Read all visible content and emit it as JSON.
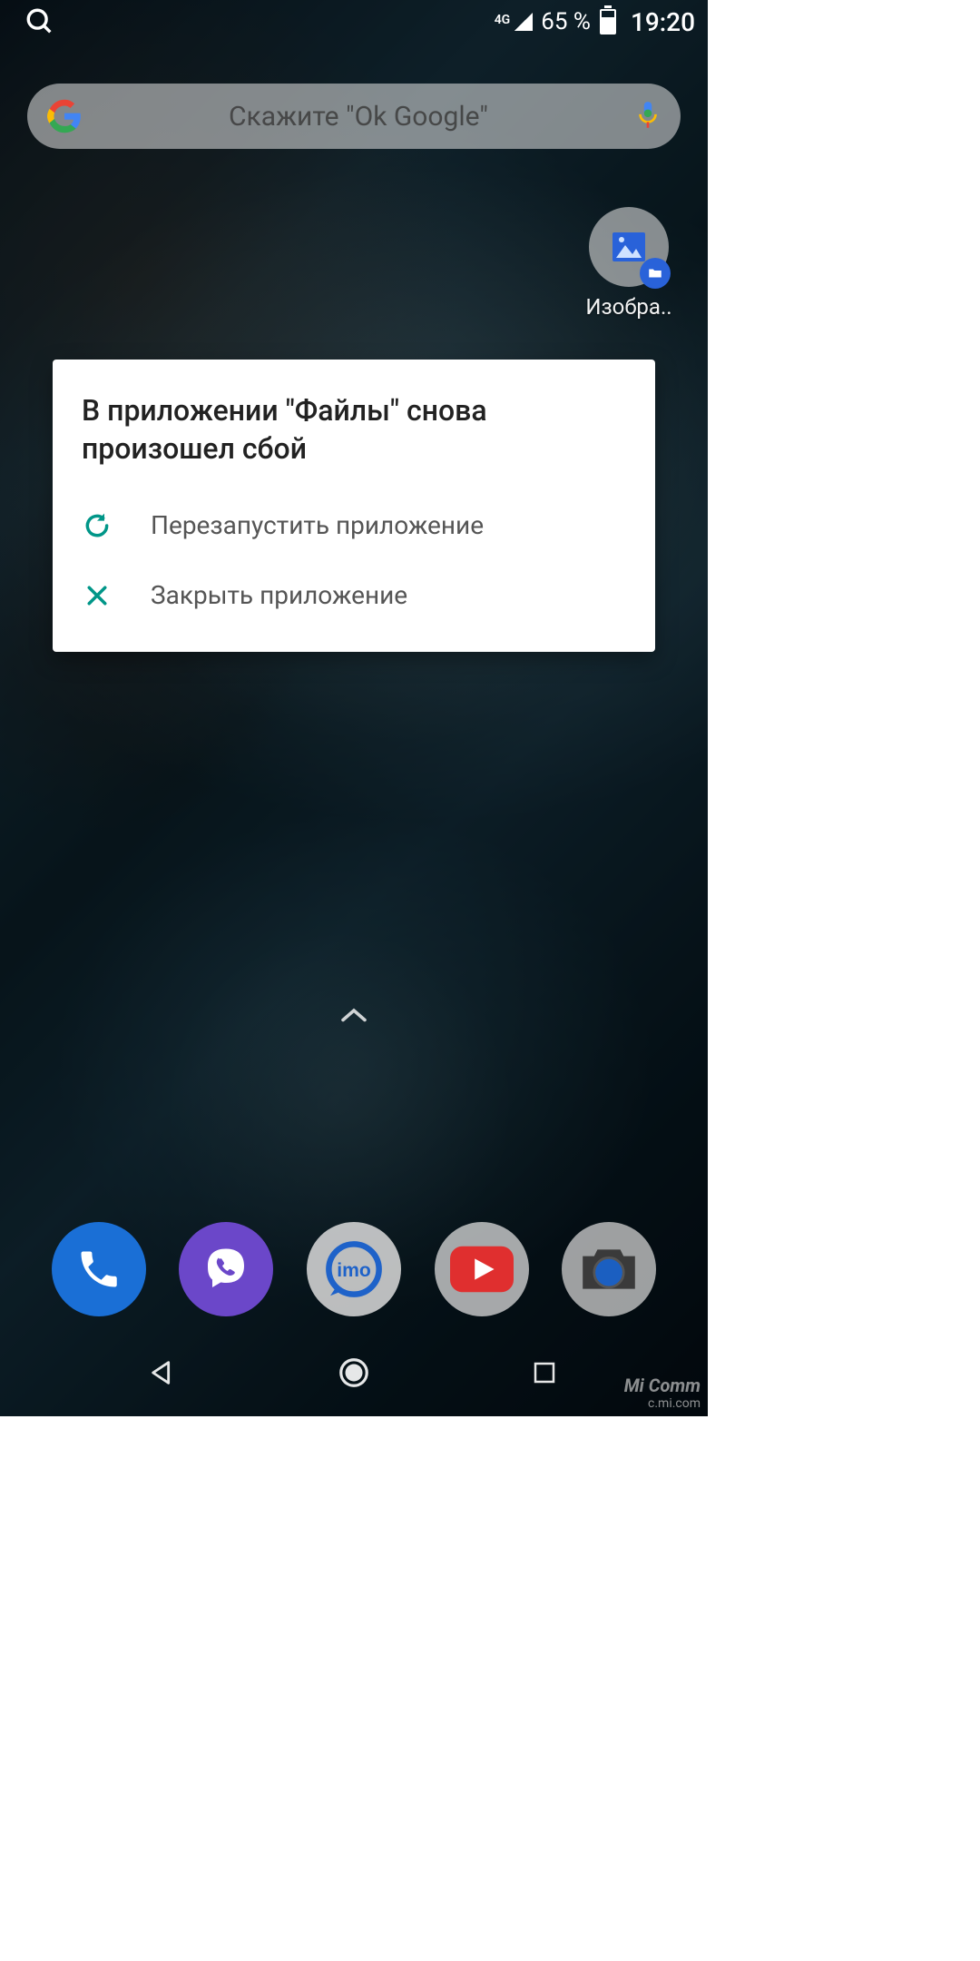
{
  "status": {
    "network_label": "4G",
    "battery_text": "65 %",
    "time": "19:20"
  },
  "search": {
    "placeholder": "Скажите \"Ok Google\""
  },
  "shortcut": {
    "label": "Изобра.."
  },
  "dialog": {
    "title": "В приложении \"Файлы\" снова произошел сбой",
    "restart_label": "Перезапустить приложение",
    "close_label": "Закрыть приложение"
  },
  "watermark": {
    "line1": "Mi Comm",
    "line2": "c.mi.com"
  },
  "colors": {
    "accent": "#009688"
  }
}
